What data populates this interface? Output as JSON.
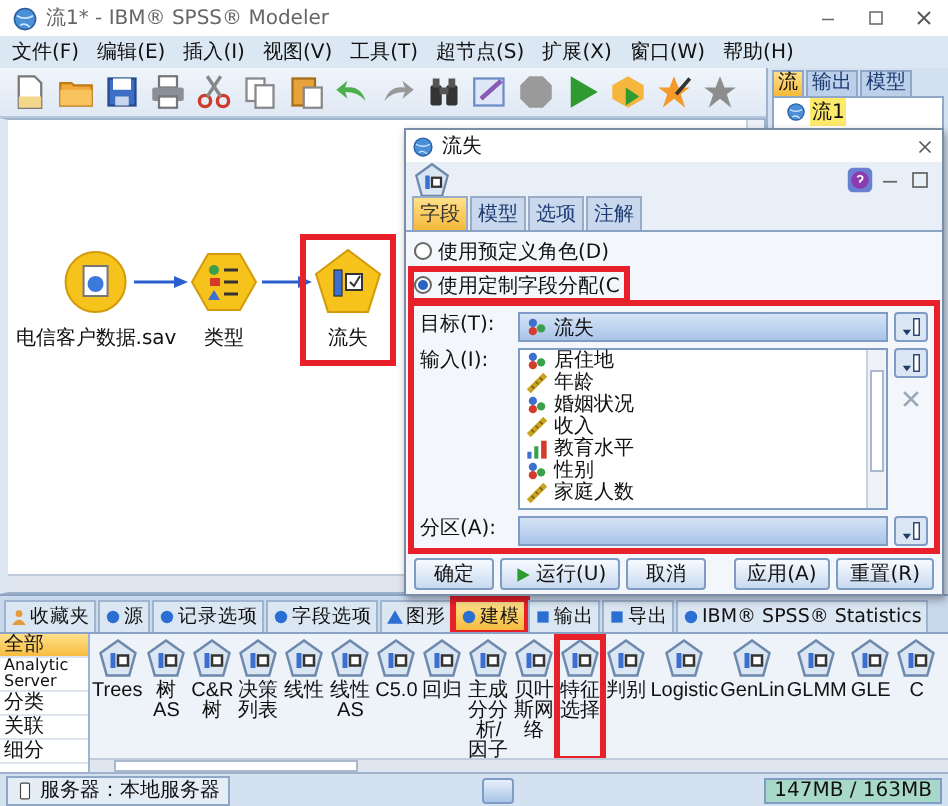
{
  "window": {
    "title": "流1* - IBM® SPSS® Modeler"
  },
  "menu": [
    "文件(F)",
    "编辑(E)",
    "插入(I)",
    "视图(V)",
    "工具(T)",
    "超节点(S)",
    "扩展(X)",
    "窗口(W)",
    "帮助(H)"
  ],
  "canvas": {
    "nodes": [
      {
        "label": "电信客户数据.sav",
        "kind": "source",
        "highlighted": false
      },
      {
        "label": "类型",
        "kind": "type",
        "highlighted": false
      },
      {
        "label": "流失",
        "kind": "feature",
        "highlighted": true
      }
    ]
  },
  "manager": {
    "tabs": [
      {
        "label": "流",
        "selected": true
      },
      {
        "label": "输出",
        "selected": false
      },
      {
        "label": "模型",
        "selected": false
      }
    ],
    "items": [
      "流1"
    ]
  },
  "dialog": {
    "title": "流失",
    "tabs": [
      {
        "label": "字段",
        "selected": true
      },
      {
        "label": "模型",
        "selected": false
      },
      {
        "label": "选项",
        "selected": false
      },
      {
        "label": "注解",
        "selected": false
      }
    ],
    "role_options": [
      {
        "label": "使用预定义角色(D)",
        "selected": false,
        "highlighted": false
      },
      {
        "label": "使用定制字段分配(C",
        "selected": true,
        "highlighted": true
      }
    ],
    "fields_highlighted": true,
    "target_label": "目标(T):",
    "target": {
      "name": "流失",
      "kind": "nominal"
    },
    "inputs_label": "输入(I):",
    "inputs": [
      {
        "name": "居住地",
        "kind": "nominal"
      },
      {
        "name": "年龄",
        "kind": "continuous"
      },
      {
        "name": "婚姻状况",
        "kind": "nominal"
      },
      {
        "name": "收入",
        "kind": "continuous"
      },
      {
        "name": "教育水平",
        "kind": "ordinal"
      },
      {
        "name": "性别",
        "kind": "nominal"
      },
      {
        "name": "家庭人数",
        "kind": "continuous"
      }
    ],
    "partition_label": "分区(A):",
    "buttons_left": [
      {
        "label": "确定",
        "kind": "plain"
      },
      {
        "label": "运行(U)",
        "kind": "run"
      },
      {
        "label": "取消",
        "kind": "plain"
      }
    ],
    "buttons_right": [
      {
        "label": "应用(A)",
        "kind": "plain"
      },
      {
        "label": "重置(R)",
        "kind": "plain"
      }
    ]
  },
  "palette": {
    "tabs": [
      {
        "label": "收藏夹",
        "kind": "favorites",
        "selected": false,
        "highlighted": false
      },
      {
        "label": "源",
        "kind": "dot",
        "selected": false,
        "highlighted": false
      },
      {
        "label": "记录选项",
        "kind": "dot",
        "selected": false,
        "highlighted": false
      },
      {
        "label": "字段选项",
        "kind": "dot",
        "selected": false,
        "highlighted": false
      },
      {
        "label": "图形",
        "kind": "triangle",
        "selected": false,
        "highlighted": false
      },
      {
        "label": "建模",
        "kind": "dot",
        "selected": true,
        "highlighted": true
      },
      {
        "label": "输出",
        "kind": "square",
        "selected": false,
        "highlighted": false
      },
      {
        "label": "导出",
        "kind": "square",
        "selected": false,
        "highlighted": false
      },
      {
        "label": "IBM® SPSS® Statistics",
        "kind": "dot",
        "selected": false,
        "highlighted": false
      }
    ],
    "categories": [
      {
        "label": "全部",
        "selected": true
      },
      {
        "label": "Analytic Server",
        "selected": false
      },
      {
        "label": "分类",
        "selected": false
      },
      {
        "label": "关联",
        "selected": false
      },
      {
        "label": "细分",
        "selected": false
      }
    ],
    "nodes": [
      {
        "label": "Trees",
        "highlighted": false
      },
      {
        "label": "树 AS",
        "highlighted": false
      },
      {
        "label": "C&R 树",
        "highlighted": false
      },
      {
        "label": "决策列表",
        "highlighted": false
      },
      {
        "label": "线性",
        "highlighted": false
      },
      {
        "label": "线性 AS",
        "highlighted": false
      },
      {
        "label": "C5.0",
        "highlighted": false
      },
      {
        "label": "回归",
        "highlighted": false
      },
      {
        "label": "主成分分析/因子",
        "highlighted": false
      },
      {
        "label": "贝叶斯网络",
        "highlighted": false
      },
      {
        "label": "特征选择",
        "highlighted": true
      },
      {
        "label": "判别",
        "highlighted": false
      },
      {
        "label": "Logistic",
        "highlighted": false
      },
      {
        "label": "GenLin",
        "highlighted": false
      },
      {
        "label": "GLMM",
        "highlighted": false
      },
      {
        "label": "GLE",
        "highlighted": false
      },
      {
        "label": "C",
        "highlighted": false
      }
    ]
  },
  "status_bar": {
    "server": "服务器：本地服务器",
    "memory": "147MB / 163MB"
  }
}
